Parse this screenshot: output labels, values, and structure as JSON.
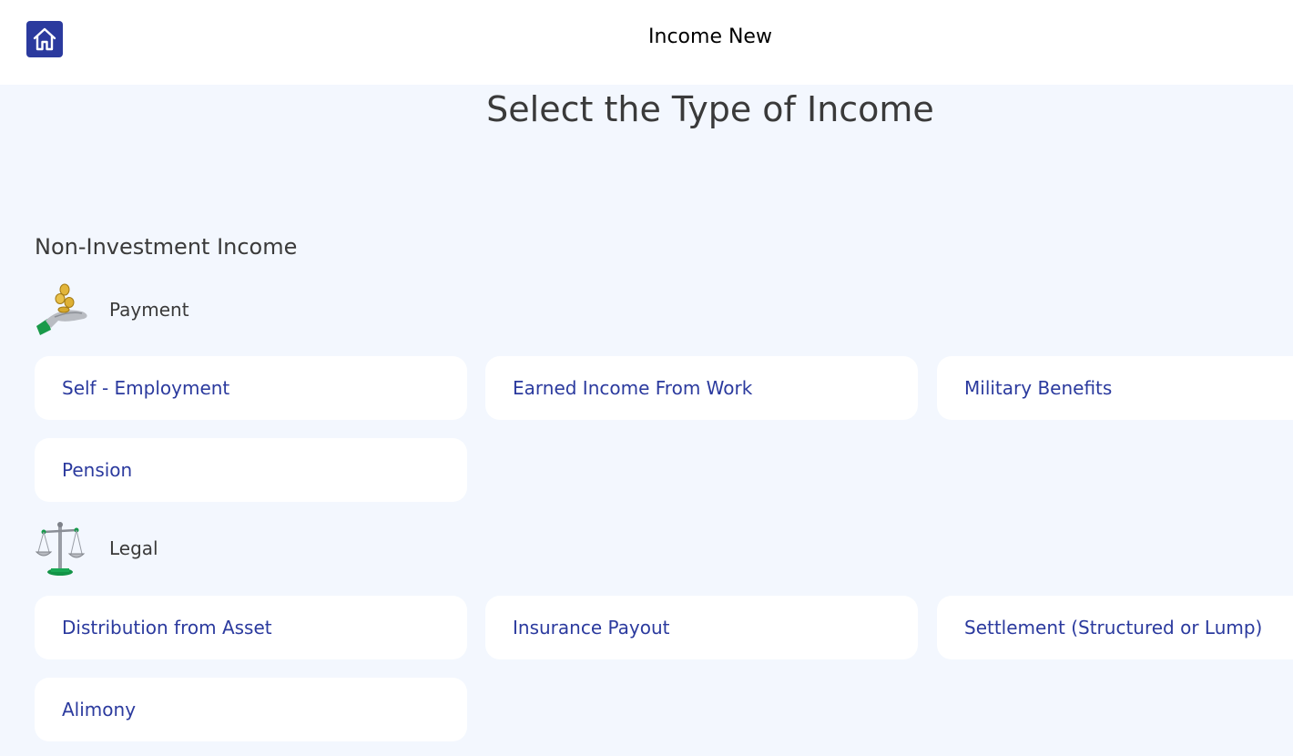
{
  "header": {
    "title": "Income New",
    "home_icon": "home-icon"
  },
  "page": {
    "title": "Select the Type of Income"
  },
  "section": {
    "title": "Non-Investment Income"
  },
  "groups": [
    {
      "label": "Payment",
      "icon": "payment-hand-coins-icon",
      "options": [
        "Self - Employment",
        "Earned Income From Work",
        "Military Benefits",
        "Pension"
      ]
    },
    {
      "label": "Legal",
      "icon": "scales-of-justice-icon",
      "options": [
        "Distribution from Asset",
        "Insurance Payout",
        "Settlement (Structured or Lump)",
        "Alimony"
      ]
    }
  ],
  "colors": {
    "accent": "#2b3a9e",
    "background": "#f3f7fe",
    "card": "#ffffff"
  }
}
